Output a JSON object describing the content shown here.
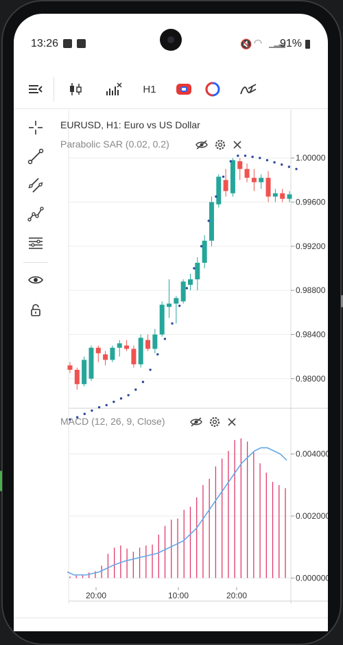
{
  "status_bar": {
    "time": "13:26",
    "battery": "91%",
    "icons": [
      "photo-icon",
      "check-icon",
      "mute-icon",
      "wifi-icon",
      "signal-icon",
      "battery-icon"
    ]
  },
  "toolbar": {
    "timeframe": "H1",
    "items": [
      "menu-icon",
      "candlestick-icon",
      "indicators-icon",
      "timeframe",
      "compare-icon",
      "color-icon",
      "drawing-icon"
    ],
    "colors": {
      "accent_red": "#e53935",
      "accent_blue": "#2962ff"
    }
  },
  "tools": [
    "crosshair-icon",
    "trendline-icon",
    "parallel-channel-icon",
    "path-icon",
    "fib-icon",
    "eye-icon",
    "lock-icon"
  ],
  "chart": {
    "title": "EURUSD, H1: Euro vs US Dollar",
    "sar_label": "Parabolic SAR (0.02, 0.2)",
    "macd_label": "MACD (12, 26, 9, Close)",
    "colors": {
      "up": "#26a69a",
      "down": "#ef5350",
      "sar": "#2a4a9c",
      "macd_hist": "#e0376a",
      "signal": "#64a7e6"
    }
  },
  "chart_data": [
    {
      "type": "candlestick",
      "title": "EURUSD, H1: Euro vs US Dollar",
      "ylim": [
        0.9775,
        1.0025
      ],
      "y_ticks": [
        "1.00000",
        "0.99600",
        "0.99200",
        "0.98800",
        "0.98400",
        "0.98000"
      ],
      "x_ticks": [
        "20:00",
        "10:00",
        "20:00"
      ],
      "ohlc": [
        [
          0.9812,
          0.9815,
          0.9805,
          0.9808
        ],
        [
          0.9808,
          0.981,
          0.979,
          0.9795
        ],
        [
          0.9795,
          0.982,
          0.9793,
          0.9817
        ],
        [
          0.98,
          0.983,
          0.9798,
          0.9828
        ],
        [
          0.9828,
          0.983,
          0.9815,
          0.9823
        ],
        [
          0.9822,
          0.9825,
          0.9812,
          0.9817
        ],
        [
          0.9817,
          0.983,
          0.9815,
          0.9828
        ],
        [
          0.9828,
          0.9835,
          0.982,
          0.9832
        ],
        [
          0.983,
          0.9835,
          0.9825,
          0.9827
        ],
        [
          0.9827,
          0.983,
          0.981,
          0.9813
        ],
        [
          0.9813,
          0.984,
          0.981,
          0.9837
        ],
        [
          0.9835,
          0.984,
          0.9825,
          0.9827
        ],
        [
          0.9827,
          0.9845,
          0.9823,
          0.984
        ],
        [
          0.984,
          0.987,
          0.9838,
          0.9867
        ],
        [
          0.9865,
          0.989,
          0.9855,
          0.9868
        ],
        [
          0.9868,
          0.9875,
          0.985,
          0.9873
        ],
        [
          0.987,
          0.989,
          0.9868,
          0.9888
        ],
        [
          0.9885,
          0.9895,
          0.988,
          0.989
        ],
        [
          0.989,
          0.991,
          0.988,
          0.9905
        ],
        [
          0.9905,
          0.993,
          0.99,
          0.9925
        ],
        [
          0.9925,
          0.9965,
          0.992,
          0.996
        ],
        [
          0.9958,
          0.9985,
          0.9955,
          0.9983
        ],
        [
          0.998,
          0.999,
          0.9965,
          0.997
        ],
        [
          0.9968,
          1.0,
          0.9965,
          0.9998
        ],
        [
          0.9997,
          1.0,
          0.998,
          0.999
        ],
        [
          0.999,
          0.9995,
          0.9978,
          0.9982
        ],
        [
          0.9982,
          0.999,
          0.997,
          0.9978
        ],
        [
          0.9978,
          0.9985,
          0.9972,
          0.9982
        ],
        [
          0.9982,
          0.9988,
          0.996,
          0.9965
        ],
        [
          0.9965,
          0.9972,
          0.996,
          0.9968
        ],
        [
          0.9968,
          0.9972,
          0.996,
          0.9963
        ],
        [
          0.9963,
          0.997,
          0.996,
          0.9967
        ]
      ],
      "sar": [
        0.9763,
        0.9765,
        0.9768,
        0.9771,
        0.9774,
        0.9776,
        0.9779,
        0.9782,
        0.9785,
        0.979,
        0.9797,
        0.9808,
        0.9822,
        0.9836,
        0.985,
        0.9866,
        0.9882,
        0.99,
        0.992,
        0.9943,
        0.9965,
        0.9983,
        0.9997,
        1.0002,
        1.0002,
        1.0001,
        1.0,
        0.9998,
        0.9996,
        0.9994,
        0.9992,
        0.999
      ]
    },
    {
      "type": "bar",
      "title": "MACD (12, 26, 9, Close)",
      "ylim": [
        -0.0005,
        0.0047
      ],
      "y_ticks": [
        "0.004000",
        "0.002000",
        "0.000000"
      ],
      "histogram": [
        5e-05,
        8e-05,
        0.0001,
        0.00018,
        0.00022,
        0.0004,
        0.00078,
        0.00098,
        0.00105,
        0.00095,
        0.00085,
        0.00098,
        0.00105,
        0.00108,
        0.0014,
        0.00168,
        0.00188,
        0.00192,
        0.0022,
        0.0023,
        0.0026,
        0.003,
        0.0032,
        0.0036,
        0.00385,
        0.0041,
        0.00445,
        0.0045,
        0.0044,
        0.00405,
        0.0037,
        0.0034,
        0.0031,
        0.003,
        0.0029
      ],
      "signal": [
        0.0002,
        0.0001,
        0.0001,
        0.0001,
        0.00015,
        0.0002,
        0.0003,
        0.0004,
        0.00048,
        0.00055,
        0.0006,
        0.00065,
        0.0007,
        0.00075,
        0.0008,
        0.0009,
        0.001,
        0.0011,
        0.0012,
        0.0014,
        0.0016,
        0.0019,
        0.0022,
        0.0025,
        0.0028,
        0.0031,
        0.0034,
        0.0037,
        0.0039,
        0.0041,
        0.0042,
        0.0042,
        0.0041,
        0.004,
        0.0038
      ]
    }
  ]
}
